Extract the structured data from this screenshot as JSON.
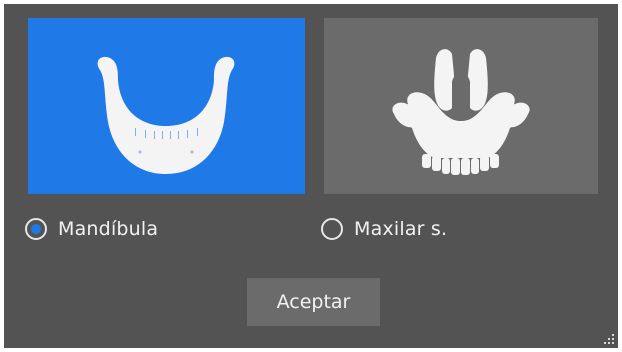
{
  "options": {
    "mandible": {
      "label": "Mandíbula",
      "selected": true,
      "icon": "mandible-icon"
    },
    "maxilla": {
      "label": "Maxilar s.",
      "selected": false,
      "icon": "maxilla-icon"
    }
  },
  "accept_label": "Aceptar",
  "colors": {
    "dialog_bg": "#535353",
    "selected_card": "#1f7ae8",
    "unselected_card": "#6b6b6b",
    "bone": "#f4f4f4",
    "text": "#f2f2f2"
  }
}
